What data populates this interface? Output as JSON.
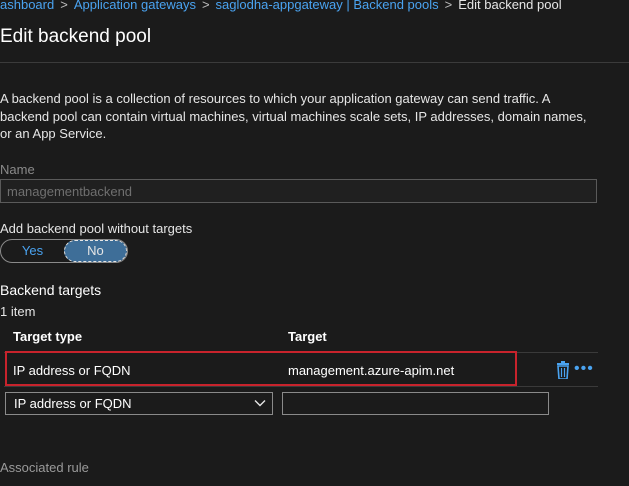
{
  "breadcrumb": {
    "items": [
      "ashboard",
      "Application gateways",
      "saglodha-appgateway | Backend pools"
    ],
    "current": "Edit backend pool"
  },
  "page": {
    "title": "Edit backend pool",
    "description": "A backend pool is a collection of resources to which your application gateway can send traffic. A backend pool can contain virtual machines, virtual machines scale sets, IP addresses, domain names, or an App Service."
  },
  "name_field": {
    "label": "Name",
    "value": "managementbackend"
  },
  "no_targets_toggle": {
    "label": "Add backend pool without targets",
    "options": [
      "Yes",
      "No"
    ],
    "selected": "No"
  },
  "backend_targets": {
    "title": "Backend targets",
    "count": "1 item",
    "columns": [
      "Target type",
      "Target"
    ],
    "rows": [
      {
        "target_type": "IP address or FQDN",
        "target": "management.azure-apim.net"
      }
    ],
    "new_row": {
      "target_type": "IP address or FQDN",
      "target": ""
    }
  },
  "associated_rule": {
    "label": "Associated rule"
  },
  "colors": {
    "accent": "#4aa3f0",
    "highlight": "#c8232c",
    "background": "#1b1b1b"
  },
  "icons": {
    "delete": "trash-icon",
    "more": "more-icon",
    "dropdown": "chevron-down-icon"
  }
}
